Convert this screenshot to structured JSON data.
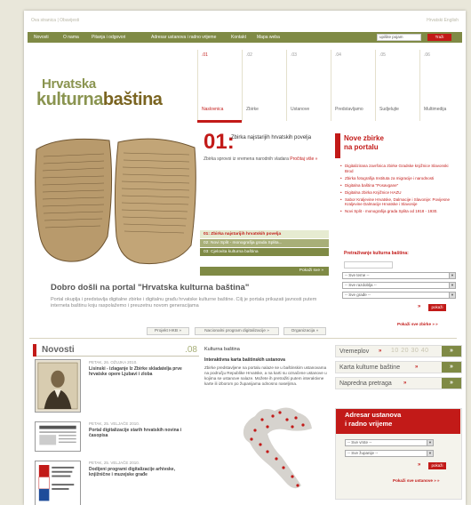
{
  "topbar": {
    "crumb": "Ova stranica | Obavijesti",
    "langs": "Hrvatski   English"
  },
  "nav": {
    "items": [
      "Novosti",
      "O nama",
      "Pitanja i odgovori",
      "Adresar ustanova i radno vrijeme",
      "Kontakt",
      "Mapa weba"
    ],
    "search_value": "upišite pojam",
    "search_button": "Traži"
  },
  "logo": {
    "line1": "Hrvatska",
    "line2_a": "kulturna",
    "line2_b": "baština"
  },
  "tabs": [
    {
      "num": ".01",
      "label": "Naslovnica"
    },
    {
      "num": ".02",
      "label": "Zbirke"
    },
    {
      "num": ".03",
      "label": "Ustanove"
    },
    {
      "num": ".04",
      "label": "Predstavljamo"
    },
    {
      "num": ".05",
      "label": "Sudjelujte"
    },
    {
      "num": ".06",
      "label": "Multimedija"
    }
  ],
  "feature": {
    "num": "01:",
    "title": "Zbirka najstarijih hrvatskih povelja",
    "text": "Zbirka sprovoi iz vremena narodnih vladara",
    "text_link": "Pročitaj više »",
    "list": [
      "01: Zbirka najstarijih hrvatskih povelja",
      "02: Novi Split - monografija grada Splita...",
      "03: Cjelovita kulturna baština"
    ],
    "more": "Pokaži sve »"
  },
  "welcome": {
    "title": "Dobro došli na portal \"Hrvatska kulturna baština\"",
    "text": "Portal okuplja i predstavlja digitalne zbirke i digitalnu građu hrvatske kulturne baštine. Cilj je portala prikazati javnosti putem interneta baštinu koju raspolažemo i preuzetnu novom generacijama"
  },
  "pills": [
    "Projekt HKB »",
    "Nacionalni program digitalizacije »",
    "Organizacija »"
  ],
  "novosti": {
    "title": "Novosti",
    "num": ".08",
    "items": [
      {
        "date": "PETAK, 26. OŽUJKA 2010.",
        "title": "Lisinski - izlaganje Iz Zbirke skladatelja prve hrvatske opere Ljubavi i zloba"
      },
      {
        "date": "PETAK, 25. VELJAČE 2010.",
        "title": "Portal digitalizacije starih hrvatskih novina i časopisa"
      },
      {
        "date": "PETAK, 25. VELJAČE 2010.",
        "title": "Dodijeni programi digitalizacije arhivske, knjižnične i muzejske građe"
      }
    ]
  },
  "kb": {
    "title": "Kulturna baština",
    "sub": "Interaktivna karta baštinskih ustanova",
    "text": "Zbirke predstavljene na portalu nalaze se u baštinskim ustanovama na području Republike Hrvatske, a na karti su označene ustanove u kojima se ustanove nalaze. Možete ih pretražiti putem interaktivne karte ili izborom po županijama odnosno naseljima."
  },
  "nove_zbirke": {
    "title1": "Nove zbirke",
    "title2": "na portalu",
    "items": [
      "Digitalizirana završnica zbirke Gradske knjižnice Slavonski Brod",
      "Zbirka fotografija Instituta za migracije i narodnosti",
      "Digitalna baština \"Posavgane\"",
      "Digitalna zbirka Knjižnice HAZU",
      "Sabor Kraljevine Hrvatske, Dalmacije i Slavonije: Povijesne Kraljevine Dalmacije Hrvatske i Slavonije",
      "Novi Split - monografija grada Splita od 1918 - 1930."
    ]
  },
  "search": {
    "title": "Pretraživanje kulturna baština:",
    "sel1": "-- Sve teme --",
    "sel2": "-- Sve razdoblja --",
    "sel3": "-- Sve građe --",
    "go": "pokaži",
    "more": "Pokaži sve zbirke » »"
  },
  "quick": [
    {
      "label": "Vremeplov",
      "nums": "10 20 30 40"
    },
    {
      "label": "Karta kulturne baštine",
      "nums": ""
    },
    {
      "label": "Napredna pretraga",
      "nums": ""
    }
  ],
  "adresar": {
    "title1": "Adresar ustanova",
    "title2": "i radno vrijeme",
    "sel1": "-- Sve vrste --",
    "sel2": "-- Sve županije --",
    "go": "pokaži",
    "more": "Pokaži sve ustanove » »"
  }
}
